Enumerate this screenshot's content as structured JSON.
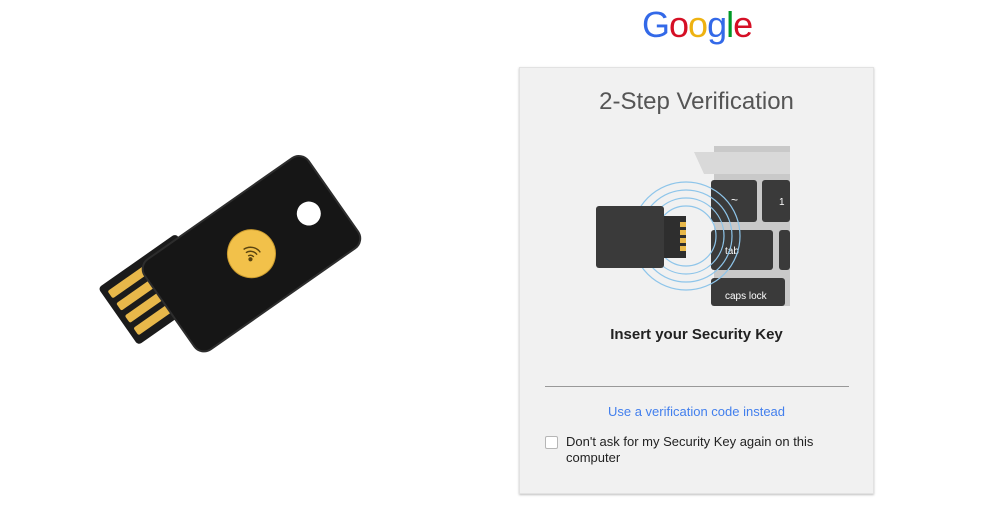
{
  "brand": {
    "logo_letters": [
      {
        "ch": "G",
        "color": "#3369e8"
      },
      {
        "ch": "o",
        "color": "#d50f25"
      },
      {
        "ch": "o",
        "color": "#eeb211"
      },
      {
        "ch": "g",
        "color": "#3369e8"
      },
      {
        "ch": "l",
        "color": "#009925"
      },
      {
        "ch": "e",
        "color": "#d50f25"
      }
    ]
  },
  "card": {
    "title": "2-Step Verification",
    "keyboard_keys": [
      "~",
      "1",
      "tab",
      "caps lock"
    ],
    "instruction": "Insert your Security Key",
    "alt_link": "Use a verification code instead",
    "remember_label": "Don't ask for my Security Key again on this computer",
    "remember_checked": false
  },
  "colors": {
    "link": "#427fed",
    "key_gold": "#f2c14a",
    "key_body": "#161616"
  }
}
